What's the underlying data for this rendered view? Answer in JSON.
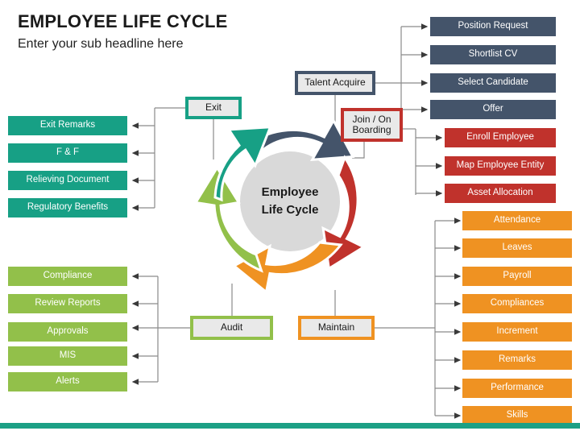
{
  "header": {
    "title": "EMPLOYEE LIFE CYCLE",
    "subtitle": "Enter your sub headline here"
  },
  "center": {
    "line1": "Employee",
    "line2": "Life Cycle"
  },
  "colors": {
    "navy": "#44546A",
    "red": "#C0322C",
    "orange": "#EF9222",
    "teal": "#17A085",
    "green": "#92C04A",
    "hub_fill": "#E9E9E9",
    "connector": "#808080",
    "accent_bar": "#1CA085"
  },
  "hubs": {
    "talent_acquire": "Talent Acquire",
    "join_on_boarding": "Join / On Boarding",
    "exit": "Exit",
    "audit": "Audit",
    "maintain": "Maintain"
  },
  "branches": {
    "talent_acquire": {
      "color": "#44546A",
      "items": [
        "Position Request",
        "Shortlist CV",
        "Select Candidate",
        "Offer"
      ]
    },
    "join_on_boarding": {
      "color": "#C0322C",
      "items": [
        "Enroll Employee",
        "Map Employee Entity",
        "Asset Allocation"
      ]
    },
    "maintain": {
      "color": "#EF9222",
      "items": [
        "Attendance",
        "Leaves",
        "Payroll",
        "Compliances",
        "Increment",
        "Remarks",
        "Performance",
        "Skills"
      ]
    },
    "exit": {
      "color": "#17A085",
      "items": [
        "Exit Remarks",
        "F & F",
        "Relieving Document",
        "Regulatory Benefits"
      ]
    },
    "audit": {
      "color": "#92C04A",
      "items": [
        "Compliance",
        "Review Reports",
        "Approvals",
        "MIS",
        "Alerts"
      ]
    }
  },
  "cycle": {
    "segments": [
      {
        "name": "talent-acquire-arc",
        "color": "#44546A"
      },
      {
        "name": "join-onboarding-arc",
        "color": "#C0322C"
      },
      {
        "name": "maintain-arc",
        "color": "#EF9222"
      },
      {
        "name": "audit-arc",
        "color": "#92C04A"
      },
      {
        "name": "exit-arc",
        "color": "#17A085"
      }
    ]
  }
}
